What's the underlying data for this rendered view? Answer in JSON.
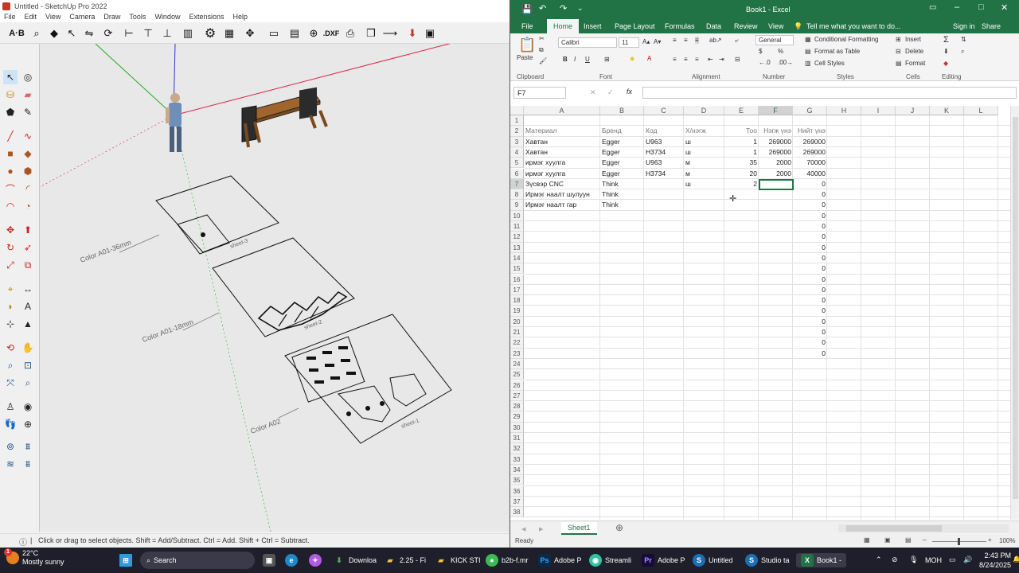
{
  "sketchup": {
    "title": "Untitled - SketchUp Pro 2022",
    "menu": [
      "File",
      "Edit",
      "View",
      "Camera",
      "Draw",
      "Tools",
      "Window",
      "Extensions",
      "Help"
    ],
    "toolbar_text": {
      "ab_label": "A·B",
      "dxf_label": ".DXF"
    },
    "labels": {
      "color1": "Color A01-36mm",
      "color2": "Color A01-18mm",
      "color3": "Color A02",
      "sheet3": "sheet-3",
      "sheet2": "sheet-2",
      "sheet1": "sheet-1"
    },
    "status": "Click or drag to select objects. Shift = Add/Subtract. Ctrl = Add. Shift + Ctrl = Subtract."
  },
  "excel": {
    "title": "Book1 - Excel",
    "tabs": [
      "File",
      "Home",
      "Insert",
      "Page Layout",
      "Formulas",
      "Data",
      "Review",
      "View"
    ],
    "tell_me": "Tell me what you want to do...",
    "sign_in": "Sign in",
    "share": "Share",
    "ribbon": {
      "paste": "Paste",
      "font_name": "Calibri",
      "font_size": "11",
      "number_format": "General",
      "conditional": "Conditional Formatting",
      "format_table": "Format as Table",
      "cell_styles": "Cell Styles",
      "insert": "Insert",
      "delete": "Delete",
      "format": "Format",
      "groups": [
        "Clipboard",
        "Font",
        "Alignment",
        "Number",
        "Styles",
        "Cells",
        "Editing"
      ]
    },
    "name_box": "F7",
    "fx": "fx",
    "columns": [
      "A",
      "B",
      "C",
      "D",
      "E",
      "F",
      "G",
      "H",
      "I",
      "J",
      "K",
      "L"
    ],
    "rows": [
      [
        "",
        "",
        "",
        "",
        "",
        "",
        ""
      ],
      [
        "Материал",
        "Бренд",
        "Код",
        "Х/нэгж",
        "Тоо",
        "Нэгж үнэ",
        "Нийт үнэ"
      ],
      [
        "Хавтан",
        "Egger",
        "U963",
        "ш",
        "1",
        "269000",
        "269000"
      ],
      [
        "Хавтан",
        "Egger",
        "H3734",
        "ш",
        "1",
        "269000",
        "269000"
      ],
      [
        "ирмэг хуулга",
        "Egger",
        "U963",
        "м",
        "35",
        "2000",
        "70000"
      ],
      [
        "ирмэг хуулга",
        "Egger",
        "H3734",
        "м",
        "20",
        "2000",
        "40000"
      ],
      [
        "Зүсвэр CNC",
        "Think",
        "",
        "ш",
        "2",
        "",
        "0"
      ],
      [
        "Ирмэг наалт шулуун",
        "Think",
        "",
        "",
        "",
        "",
        "0"
      ],
      [
        "Ирмэг наалт гар",
        "Think",
        "",
        "",
        "",
        "",
        "0"
      ],
      [
        "",
        "",
        "",
        "",
        "",
        "",
        "0"
      ],
      [
        "",
        "",
        "",
        "",
        "",
        "",
        "0"
      ],
      [
        "",
        "",
        "",
        "",
        "",
        "",
        "0"
      ],
      [
        "",
        "",
        "",
        "",
        "",
        "",
        "0"
      ],
      [
        "",
        "",
        "",
        "",
        "",
        "",
        "0"
      ],
      [
        "",
        "",
        "",
        "",
        "",
        "",
        "0"
      ],
      [
        "",
        "",
        "",
        "",
        "",
        "",
        "0"
      ],
      [
        "",
        "",
        "",
        "",
        "",
        "",
        "0"
      ],
      [
        "",
        "",
        "",
        "",
        "",
        "",
        "0"
      ],
      [
        "",
        "",
        "",
        "",
        "",
        "",
        "0"
      ],
      [
        "",
        "",
        "",
        "",
        "",
        "",
        "0"
      ],
      [
        "",
        "",
        "",
        "",
        "",
        "",
        "0"
      ],
      [
        "",
        "",
        "",
        "",
        "",
        "",
        "0"
      ],
      [
        "",
        "",
        "",
        "",
        "",
        "",
        "0"
      ],
      [
        "",
        "",
        "",
        "",
        "",
        "",
        ""
      ],
      [
        "",
        "",
        "",
        "",
        "",
        "",
        ""
      ],
      [
        "",
        "",
        "",
        "",
        "",
        "",
        ""
      ],
      [
        "",
        "",
        "",
        "",
        "",
        "",
        ""
      ],
      [
        "",
        "",
        "",
        "",
        "",
        "",
        ""
      ],
      [
        "",
        "",
        "",
        "",
        "",
        "",
        ""
      ],
      [
        "",
        "",
        "",
        "",
        "",
        "",
        ""
      ],
      [
        "",
        "",
        "",
        "",
        "",
        "",
        ""
      ],
      [
        "",
        "",
        "",
        "",
        "",
        "",
        ""
      ],
      [
        "",
        "",
        "",
        "",
        "",
        "",
        ""
      ],
      [
        "",
        "",
        "",
        "",
        "",
        "",
        ""
      ],
      [
        "",
        "",
        "",
        "",
        "",
        "",
        ""
      ],
      [
        "",
        "",
        "",
        "",
        "",
        "",
        ""
      ],
      [
        "",
        "",
        "",
        "",
        "",
        "",
        ""
      ],
      [
        "",
        "",
        "",
        "",
        "",
        "",
        ""
      ]
    ],
    "sheet_tab": "Sheet1",
    "status_ready": "Ready",
    "zoom": "100%"
  },
  "taskbar": {
    "weather_temp": "22°C",
    "weather_desc": "Mostly sunny",
    "search": "Search",
    "items": [
      "Downloa",
      "2.25 - Fi",
      "KICK STI",
      "b2b-f.mr",
      "Adobe P",
      "Streamli",
      "Adobe P",
      "Untitled",
      "Studio ta",
      "Book1 -"
    ],
    "lang": "MOH",
    "time": "2:43 PM",
    "date": "8/24/2025",
    "notif": "1"
  }
}
